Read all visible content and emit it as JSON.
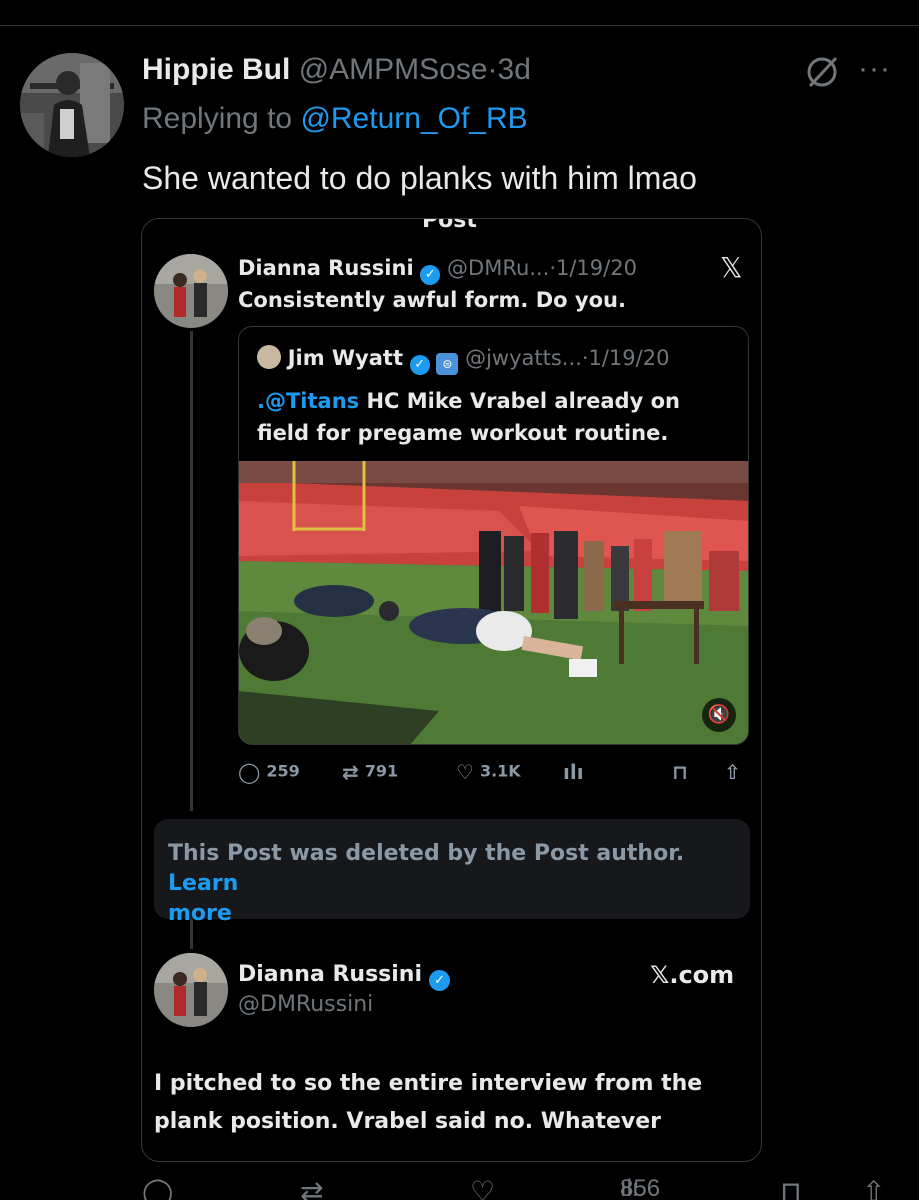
{
  "tweet": {
    "author_name": "Hippie Bul",
    "author_handle": "@AMPMSose",
    "separator": "·",
    "time": "3d",
    "replying_prefix": "Replying to",
    "replying_to": "@Return_Of_RB",
    "text": "She wanted to do planks with him lmao",
    "more_label": "···"
  },
  "screenshot": {
    "cut_header": "Post",
    "post1": {
      "name": "Dianna Russini",
      "handle": "@DMRu...",
      "separator": "·",
      "date": "1/19/20",
      "text": "Consistently awful form. Do you.",
      "x_label": "𝕏"
    },
    "quoted": {
      "name": "Jim Wyatt",
      "handle": "@jwyatts...",
      "separator": "·",
      "date": "1/19/20",
      "mention": ".@Titans",
      "text_line1": " HC Mike Vrabel already on",
      "text_line2": "field for pregame workout routine."
    },
    "actions": {
      "replies": "259",
      "reposts": "791",
      "likes": "3.1K"
    },
    "deleted": {
      "text": "This Post was deleted by the Post author.",
      "link_part1": "Learn",
      "link_part2": "more"
    },
    "post2": {
      "name": "Dianna Russini",
      "handle": "@DMRussini",
      "source": "𝕏.com",
      "text_line1": "I pitched to so the entire interview from the",
      "text_line2": "plank position. Vrabel said no. Whatever"
    }
  },
  "bottom_bar": {
    "views": "856"
  },
  "colors": {
    "background": "#000000",
    "text_primary": "#e7e9ea",
    "text_secondary": "#71767b",
    "accent": "#1d9bf0",
    "border": "#2f3336",
    "verified": "#1d9bf0"
  }
}
